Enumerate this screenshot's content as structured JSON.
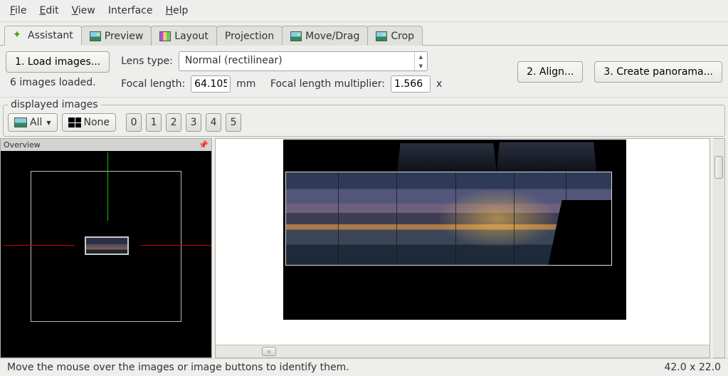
{
  "menubar": {
    "file": "File",
    "edit": "Edit",
    "view": "View",
    "interface": "Interface",
    "help": "Help"
  },
  "tabs": {
    "assistant": "Assistant",
    "preview": "Preview",
    "layout": "Layout",
    "projection": "Projection",
    "move_drag": "Move/Drag",
    "crop": "Crop",
    "active": "assistant"
  },
  "assistant": {
    "load_images_btn": "1. Load images...",
    "images_loaded": "6 images loaded.",
    "lens_type_label": "Lens type:",
    "lens_type_value": "Normal (rectilinear)",
    "focal_length_label": "Focal length:",
    "focal_length_value": "64.105",
    "focal_length_unit": "mm",
    "multiplier_label": "Focal length multiplier:",
    "multiplier_value": "1.566",
    "multiplier_unit": "x",
    "align_btn": "2. Align...",
    "create_btn": "3. Create panorama..."
  },
  "displayed": {
    "legend": "displayed images",
    "all": "All",
    "none": "None",
    "indices": [
      "0",
      "1",
      "2",
      "3",
      "4",
      "5"
    ]
  },
  "overview": {
    "title": "Overview"
  },
  "status": {
    "hint": "Move the mouse over the images or image buttons to identify them.",
    "coords": "42.0 x 22.0"
  }
}
